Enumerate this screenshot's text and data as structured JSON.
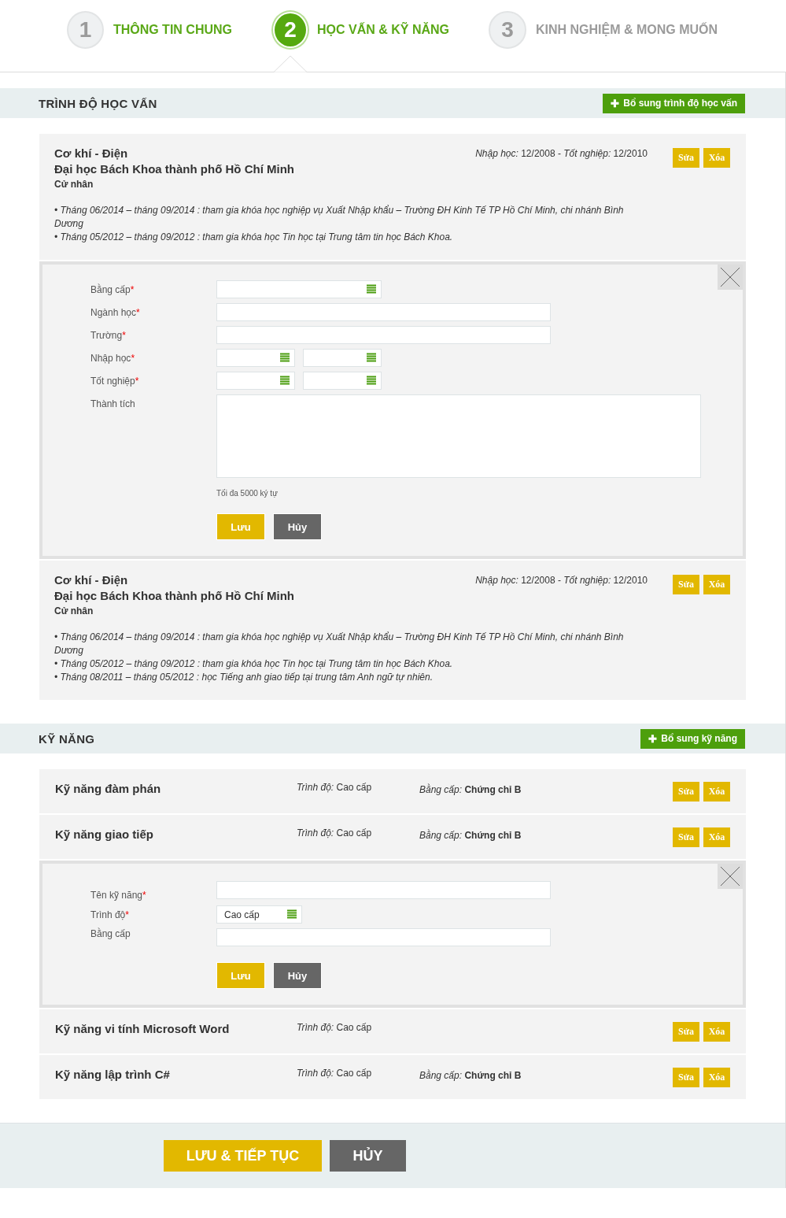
{
  "steps": [
    {
      "number": "1",
      "label": "THÔNG TIN CHUNG",
      "kind": "done"
    },
    {
      "number": "2",
      "label": "HỌC VẤN & KỸ NĂNG",
      "kind": "active"
    },
    {
      "number": "3",
      "label": "KINH NGHIỆM & MONG MUỐN",
      "kind": "pending"
    }
  ],
  "required_mark": "*",
  "education": {
    "title": "TRÌNH ĐỘ HỌC VẤN",
    "add_icon": "✚",
    "add_button": "Bổ sung trình độ học vấn",
    "entries": [
      {
        "kind": "record",
        "major": "Cơ khí - Điện",
        "school": "Đại học Bách Khoa thành phố Hồ Chí Minh",
        "degree": "Cử nhân",
        "dates": "*Nhập học:* 12/2008 - *Tốt nghiệp:* 12/2010",
        "notes": [
          "• Tháng 06/2014 – tháng 09/2014 : tham gia khóa học nghiệp vụ Xuất Nhập khẩu – Trường ĐH Kinh Tế TP Hồ Chí Minh, chi nhánh Bình Dương",
          "• Tháng 05/2012 – tháng 09/2012 : tham gia khóa học Tin học tại Trung tâm tin học Bách Khoa."
        ],
        "edit": "Sửa",
        "delete": "Xóa"
      },
      {
        "kind": "form",
        "fields": [
          {
            "kind": "select",
            "label": "Bằng cấp",
            "required": true
          },
          {
            "kind": "text",
            "label": "Ngành học",
            "required": true
          },
          {
            "kind": "text",
            "label": "Trường",
            "required": true
          },
          {
            "kind": "date-pair",
            "label": "Nhập học",
            "required": true
          },
          {
            "kind": "date-pair",
            "label": "Tốt nghiệp",
            "required": true
          },
          {
            "kind": "textarea",
            "label": "Thành tích",
            "required": false,
            "hint": "Tối đa 5000 ký tự"
          }
        ],
        "save": "Lưu",
        "cancel": "Hủy"
      },
      {
        "kind": "record",
        "major": "Cơ khí - Điện",
        "school": "Đại học Bách Khoa thành phố Hồ Chí Minh",
        "degree": "Cử nhân",
        "dates": "*Nhập học:* 12/2008 - *Tốt nghiệp:* 12/2010",
        "notes": [
          "• Tháng 06/2014 – tháng 09/2014 : tham gia khóa học nghiệp vụ Xuất Nhập khẩu – Trường ĐH Kinh Tế TP Hồ Chí Minh, chi nhánh Bình Dương",
          "• Tháng 05/2012 – tháng 09/2012 : tham gia khóa học Tin học tại Trung tâm tin học Bách Khoa.",
          "• Tháng 08/2011 – tháng 05/2012 : học Tiếng anh giao tiếp tại trung tâm Anh ngữ tự nhiên."
        ],
        "edit": "Sửa",
        "delete": "Xóa"
      }
    ]
  },
  "skills": {
    "title": "KỸ NĂNG",
    "add_icon": "✚",
    "add_button": "Bổ sung kỹ năng",
    "entries": [
      {
        "kind": "record",
        "name": "Kỹ năng đàm phán",
        "level": "*Trình độ:* Cao cấp",
        "certificate": "*Bằng cấp:* **Chứng chỉ B**",
        "edit": "Sửa",
        "delete": "Xóa"
      },
      {
        "kind": "record",
        "name": "Kỹ năng giao tiếp",
        "level": "*Trình độ:* Cao cấp",
        "certificate": "*Bằng cấp:* **Chứng chỉ B**",
        "edit": "Sửa",
        "delete": "Xóa"
      },
      {
        "kind": "form",
        "fields": [
          {
            "kind": "text",
            "label": "Tên kỹ năng",
            "required": true
          },
          {
            "kind": "select",
            "label": "Trình độ",
            "required": true,
            "value": "Cao cấp"
          },
          {
            "kind": "text",
            "label": "Bằng cấp",
            "required": false
          }
        ],
        "save": "Lưu",
        "cancel": "Hủy"
      },
      {
        "kind": "record",
        "name": "Kỹ năng vi tính Microsoft Word",
        "level": "*Trình độ:* Cao cấp",
        "edit": "Sửa",
        "delete": "Xóa"
      },
      {
        "kind": "record",
        "name": "Kỹ năng lập trình C#",
        "level": "*Trình độ:* Cao cấp",
        "certificate": "*Bằng cấp:* **Chứng chỉ B**",
        "edit": "Sửa",
        "delete": "Xóa"
      }
    ]
  },
  "footer": {
    "save": "LƯU & TIẾP TỤC",
    "cancel": "HỦY"
  }
}
